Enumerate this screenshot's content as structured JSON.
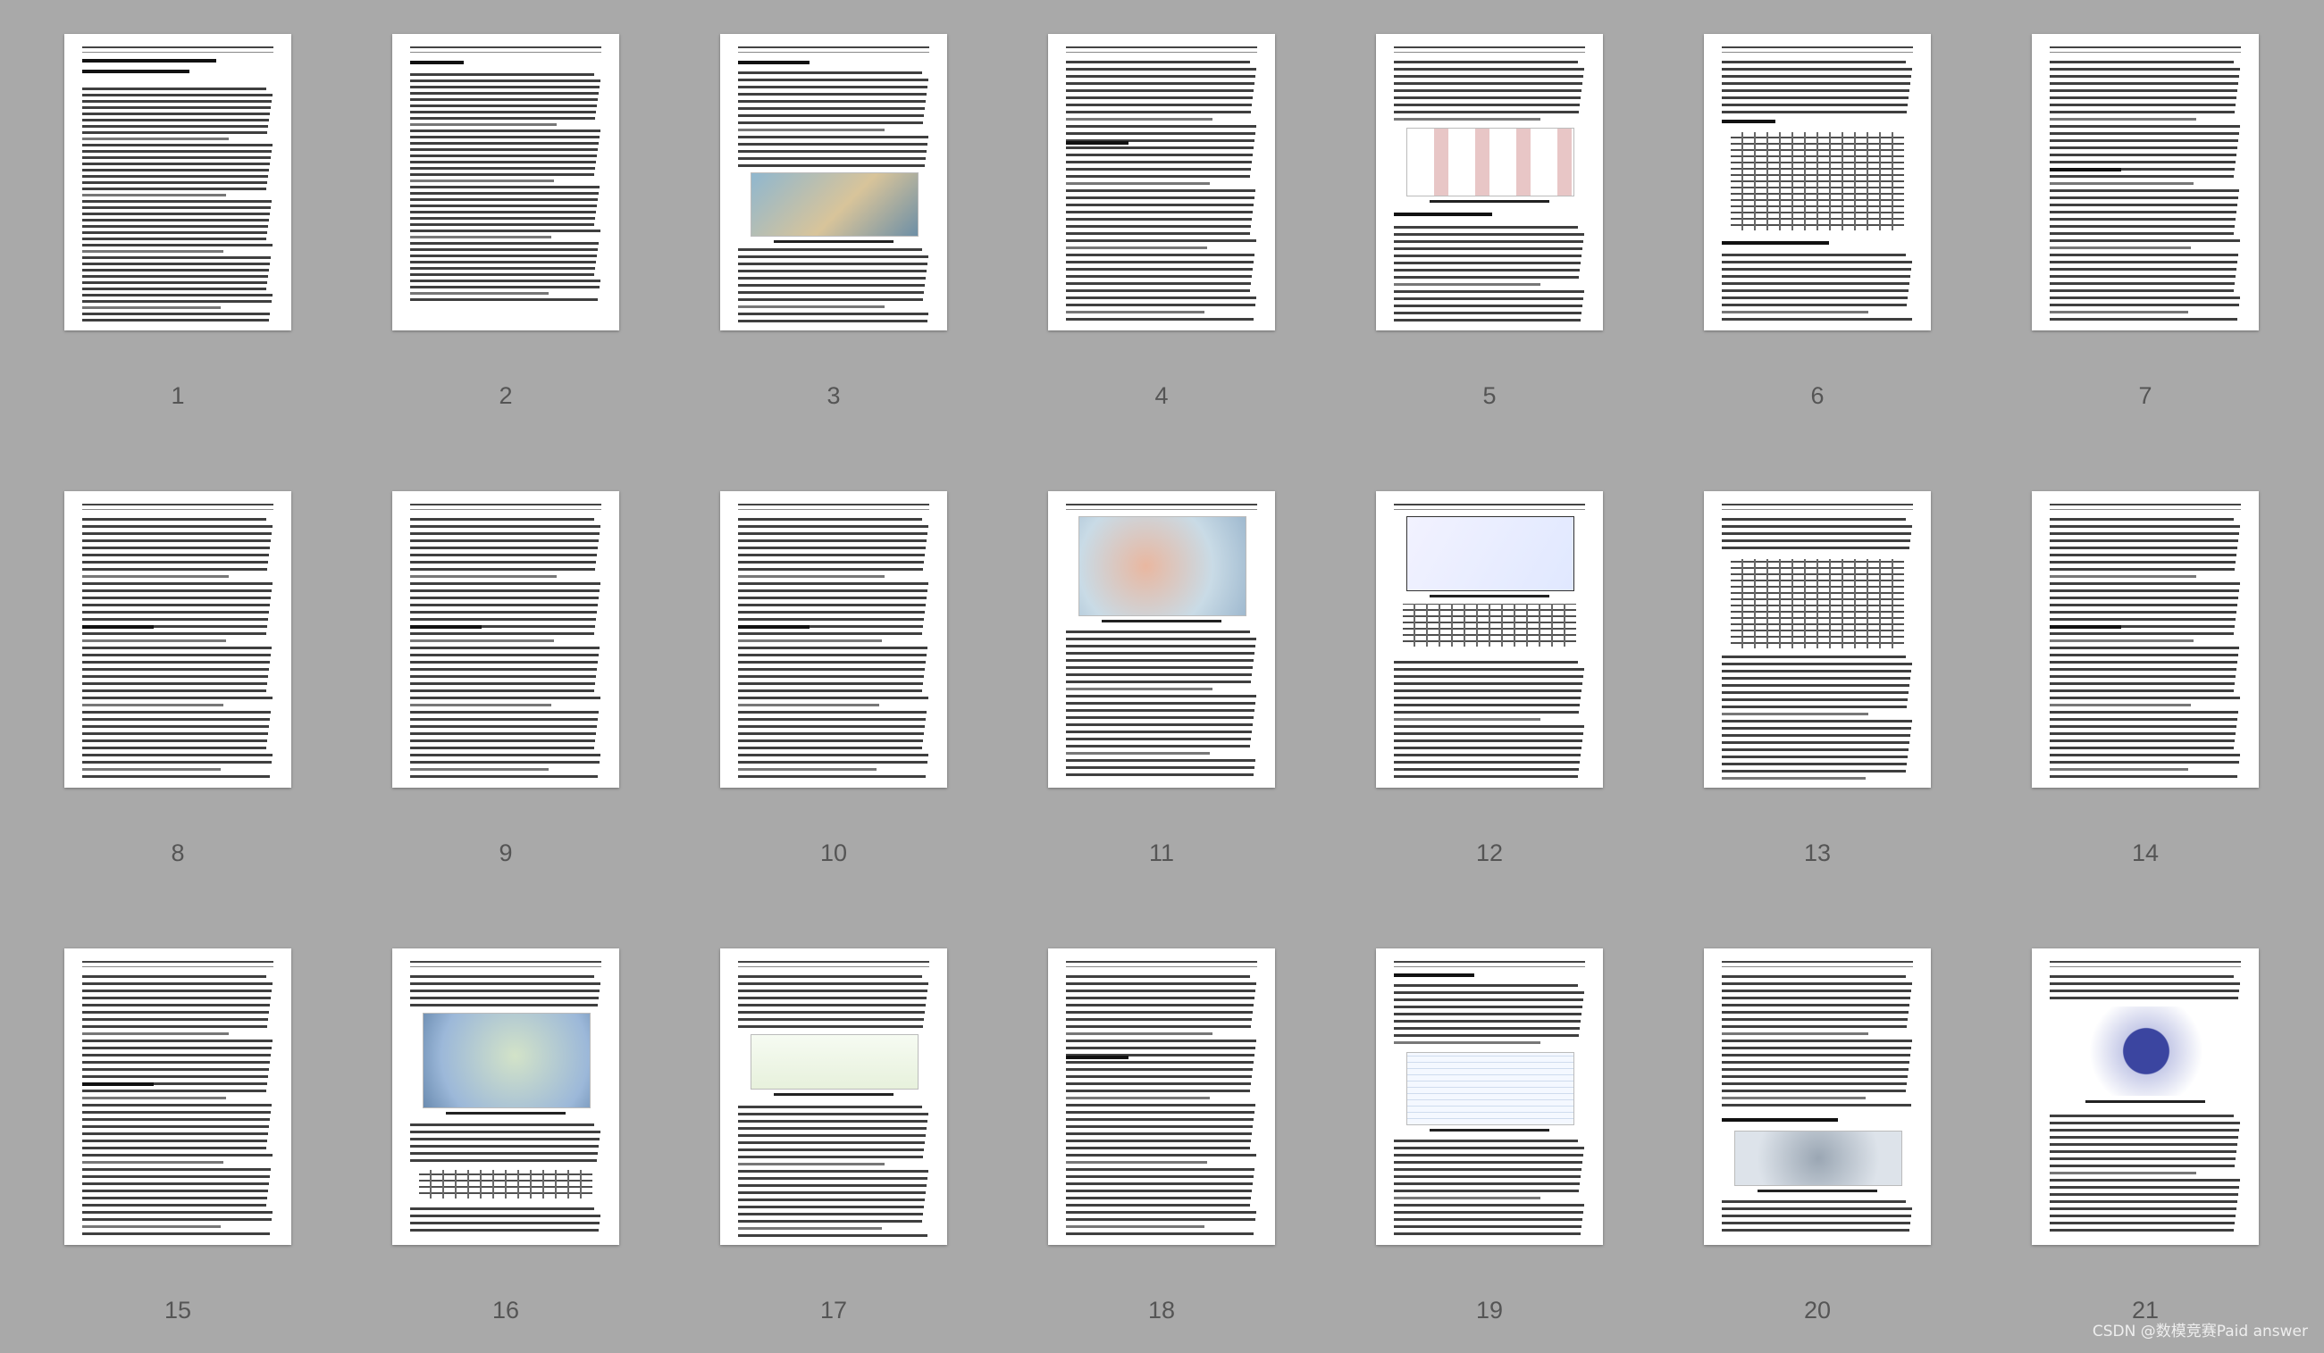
{
  "pages": [
    {
      "num": "1",
      "kind": "title"
    },
    {
      "num": "2",
      "kind": "toc"
    },
    {
      "num": "3",
      "kind": "figure-top"
    },
    {
      "num": "4",
      "kind": "text"
    },
    {
      "num": "5",
      "kind": "diagram"
    },
    {
      "num": "6",
      "kind": "table-mid"
    },
    {
      "num": "7",
      "kind": "text-eq"
    },
    {
      "num": "8",
      "kind": "text-eq"
    },
    {
      "num": "9",
      "kind": "text-eq"
    },
    {
      "num": "10",
      "kind": "text-eq"
    },
    {
      "num": "11",
      "kind": "map-top"
    },
    {
      "num": "12",
      "kind": "chart-top"
    },
    {
      "num": "13",
      "kind": "table-top"
    },
    {
      "num": "14",
      "kind": "text-eq"
    },
    {
      "num": "15",
      "kind": "text-eq"
    },
    {
      "num": "16",
      "kind": "map-mid"
    },
    {
      "num": "17",
      "kind": "charts-mid"
    },
    {
      "num": "18",
      "kind": "text"
    },
    {
      "num": "19",
      "kind": "diagram-mid"
    },
    {
      "num": "20",
      "kind": "image-bottom"
    },
    {
      "num": "21",
      "kind": "radar"
    }
  ],
  "colors": {
    "background": "#a9a9a9",
    "page": "#ffffff",
    "page_number": "#555555"
  },
  "watermark": "CSDN @数模竞赛Paid answer"
}
